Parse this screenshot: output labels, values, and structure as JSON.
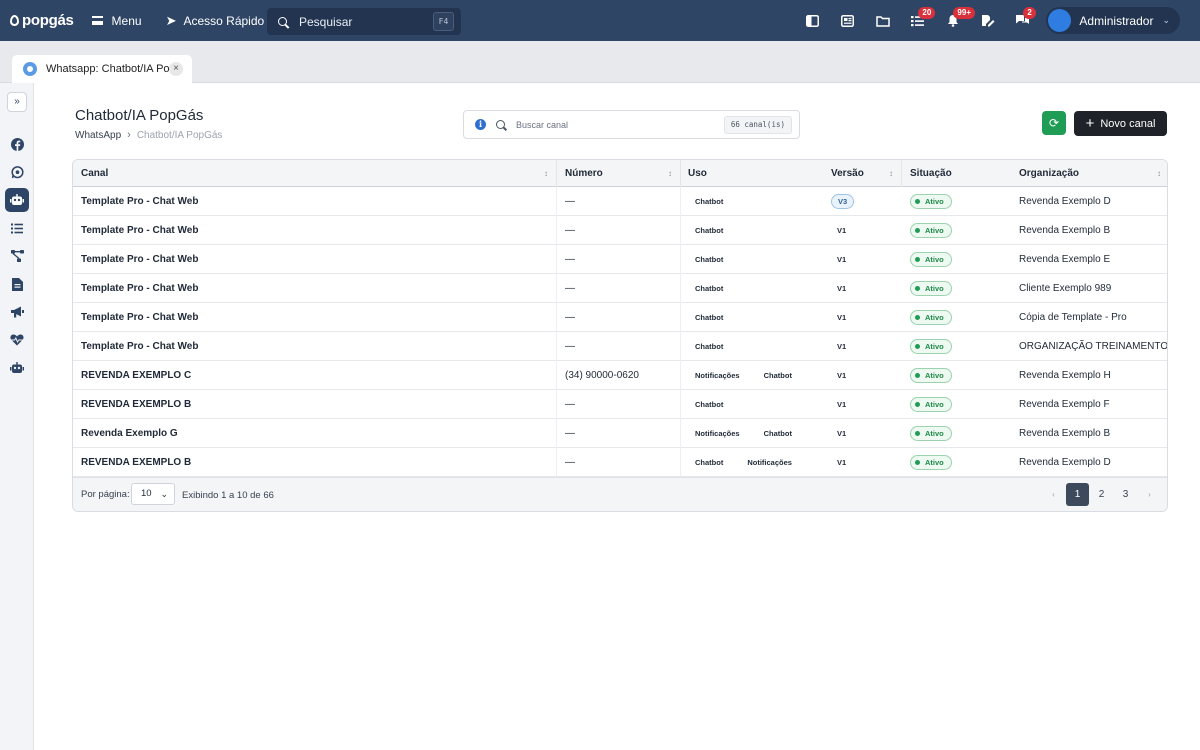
{
  "topbar": {
    "logo": "popgás",
    "menu_label": "Menu",
    "quick_label": "Acesso Rápido",
    "search_placeholder": "Pesquisar",
    "search_kbd": "F4",
    "badges": {
      "tasks": "20",
      "notifications": "99+",
      "chats": "2"
    },
    "user_name": "Administrador"
  },
  "tabs": [
    {
      "label": "Whatsapp: Chatbot/IA Po..."
    }
  ],
  "page": {
    "title": "Chatbot/IA PopGás",
    "breadcrumb": {
      "parent": "WhatsApp",
      "separator": "›",
      "current": "Chatbot/IA PopGás"
    },
    "search_placeholder": "Buscar canal",
    "count_badge": "66 canal(is)",
    "new_button": "Novo canal"
  },
  "table": {
    "columns": [
      "Canal",
      "Número",
      "Uso",
      "Versão",
      "Situação",
      "Organização"
    ],
    "rows": [
      {
        "canal": "Template Pro - Chat Web",
        "numero": "—",
        "uso": [
          "Chatbot"
        ],
        "versao": "V3",
        "situacao": "Ativo",
        "org": "Revenda Exemplo D"
      },
      {
        "canal": "Template Pro - Chat Web",
        "numero": "—",
        "uso": [
          "Chatbot"
        ],
        "versao": "V1",
        "situacao": "Ativo",
        "org": "Revenda Exemplo B"
      },
      {
        "canal": "Template Pro - Chat Web",
        "numero": "—",
        "uso": [
          "Chatbot"
        ],
        "versao": "V1",
        "situacao": "Ativo",
        "org": "Revenda Exemplo E"
      },
      {
        "canal": "Template Pro - Chat Web",
        "numero": "—",
        "uso": [
          "Chatbot"
        ],
        "versao": "V1",
        "situacao": "Ativo",
        "org": "Cliente Exemplo 989"
      },
      {
        "canal": "Template Pro - Chat Web",
        "numero": "—",
        "uso": [
          "Chatbot"
        ],
        "versao": "V1",
        "situacao": "Ativo",
        "org": "Cópia de Template - Pro"
      },
      {
        "canal": "Template Pro - Chat Web",
        "numero": "—",
        "uso": [
          "Chatbot"
        ],
        "versao": "V1",
        "situacao": "Ativo",
        "org": "ORGANIZAÇÃO TREINAMENTO"
      },
      {
        "canal": "REVENDA EXEMPLO C",
        "numero": "(34) 90000-0620",
        "uso": [
          "Notificações",
          "Chatbot"
        ],
        "versao": "V1",
        "situacao": "Ativo",
        "org": "Revenda Exemplo H"
      },
      {
        "canal": "REVENDA EXEMPLO B",
        "numero": "—",
        "uso": [
          "Chatbot"
        ],
        "versao": "V1",
        "situacao": "Ativo",
        "org": "Revenda Exemplo F"
      },
      {
        "canal": "Revenda Exemplo G",
        "numero": "—",
        "uso": [
          "Notificações",
          "Chatbot"
        ],
        "versao": "V1",
        "situacao": "Ativo",
        "org": "Revenda Exemplo B"
      },
      {
        "canal": "REVENDA EXEMPLO B",
        "numero": "—",
        "uso": [
          "Chatbot",
          "Notificações"
        ],
        "versao": "V1",
        "situacao": "Ativo",
        "org": "Revenda Exemplo D"
      }
    ]
  },
  "footer": {
    "per_page_label": "Por página:",
    "per_page_value": "10",
    "showing": "Exibindo 1 a 10 de 66",
    "pages": [
      "1",
      "2",
      "3"
    ],
    "current_page": "1",
    "prev": "‹",
    "next": "›"
  },
  "sidebar": {
    "items": [
      "facebook-icon",
      "whatsapp-icon",
      "robot-icon",
      "list-icon",
      "flow-icon",
      "document-icon",
      "megaphone-icon",
      "heart-pulse-icon",
      "bot-icon"
    ],
    "active": "robot-icon"
  },
  "colors": {
    "topbar": "#2f4566",
    "accent_green": "#1f9d55",
    "dark_button": "#1f2329",
    "badge_red": "#d9313c"
  }
}
